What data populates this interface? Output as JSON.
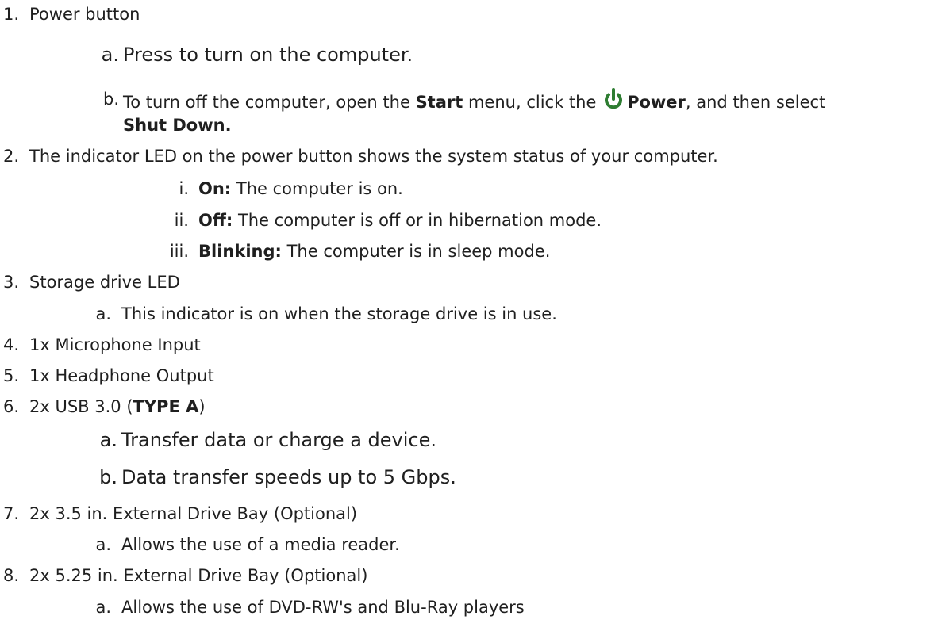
{
  "items": [
    {
      "marker": "1.",
      "text": "Power button"
    },
    {
      "marker": "a.",
      "text": "Press to turn on the computer."
    },
    {
      "marker": "b.",
      "parts": [
        "To turn off the computer, open the ",
        "Start",
        " menu, click the ",
        "Power",
        ", and then select"
      ],
      "cont": "Shut Down.",
      "icon": "power-icon"
    },
    {
      "marker": "2.",
      "text": "The indicator LED on the power button shows the system status of your computer."
    },
    {
      "marker": "i.",
      "label": "On:",
      "text": " The computer is on."
    },
    {
      "marker": "ii.",
      "label": "Off:",
      "text": " The computer is off or in hibernation mode."
    },
    {
      "marker": "iii.",
      "label": "Blinking:",
      "text": " The computer is in sleep mode."
    },
    {
      "marker": "3.",
      "text": "Storage drive LED"
    },
    {
      "marker": "a.",
      "text": "This indicator is on when the storage drive is in use."
    },
    {
      "marker": "4.",
      "text": "1x Microphone Input"
    },
    {
      "marker": "5.",
      "text": "1x Headphone Output"
    },
    {
      "marker": "6.",
      "text": "2x USB 3.0 (",
      "bold": "TYPE A",
      "after": ")"
    },
    {
      "marker": "a.",
      "text": "Transfer data or charge a device."
    },
    {
      "marker": "b.",
      "text": "Data transfer speeds up to 5 Gbps."
    },
    {
      "marker": "7.",
      "text": "2x 3.5 in. External Drive Bay (Optional)"
    },
    {
      "marker": "a.",
      "text": "Allows the use of a media reader."
    },
    {
      "marker": "8.",
      "text": "2x 5.25 in. External Drive Bay (Optional)"
    },
    {
      "marker": "a.",
      "text": "Allows the use of DVD-RW's and Blu-Ray players"
    }
  ],
  "colors": {
    "text": "#1f1f1f",
    "icon": "#2e7d32"
  }
}
